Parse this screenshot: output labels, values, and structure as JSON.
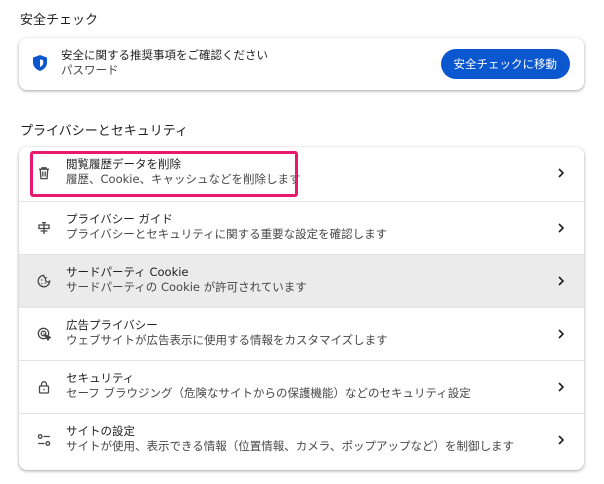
{
  "safety_check": {
    "section_title": "安全チェック",
    "message": "安全に関する推奨事項をご確認ください",
    "sub": "パスワード",
    "button_label": "安全チェックに移動"
  },
  "privacy": {
    "section_title": "プライバシーとセキュリティ",
    "items": [
      {
        "title": "閲覧履歴データを削除",
        "subtitle": "履歴、Cookie、キャッシュなどを削除します",
        "icon": "trash-icon"
      },
      {
        "title": "プライバシー ガイド",
        "subtitle": "プライバシーとセキュリティに関する重要な設定を確認します",
        "icon": "privacy-guide-icon"
      },
      {
        "title": "サードパーティ Cookie",
        "subtitle": "サードパーティの Cookie が許可されています",
        "icon": "cookie-icon"
      },
      {
        "title": "広告プライバシー",
        "subtitle": "ウェブサイトが広告表示に使用する情報をカスタマイズします",
        "icon": "ad-privacy-icon"
      },
      {
        "title": "セキュリティ",
        "subtitle": "セーフ ブラウジング（危険なサイトからの保護機能）などのセキュリティ設定",
        "icon": "lock-icon"
      },
      {
        "title": "サイトの設定",
        "subtitle": "サイトが使用、表示できる情報（位置情報、カメラ、ポップアップなど）を制御します",
        "icon": "site-settings-icon"
      }
    ]
  },
  "colors": {
    "accent_blue": "#0b57d0",
    "highlight_pink": "#e9186f",
    "hover_row": "#ebebeb"
  }
}
